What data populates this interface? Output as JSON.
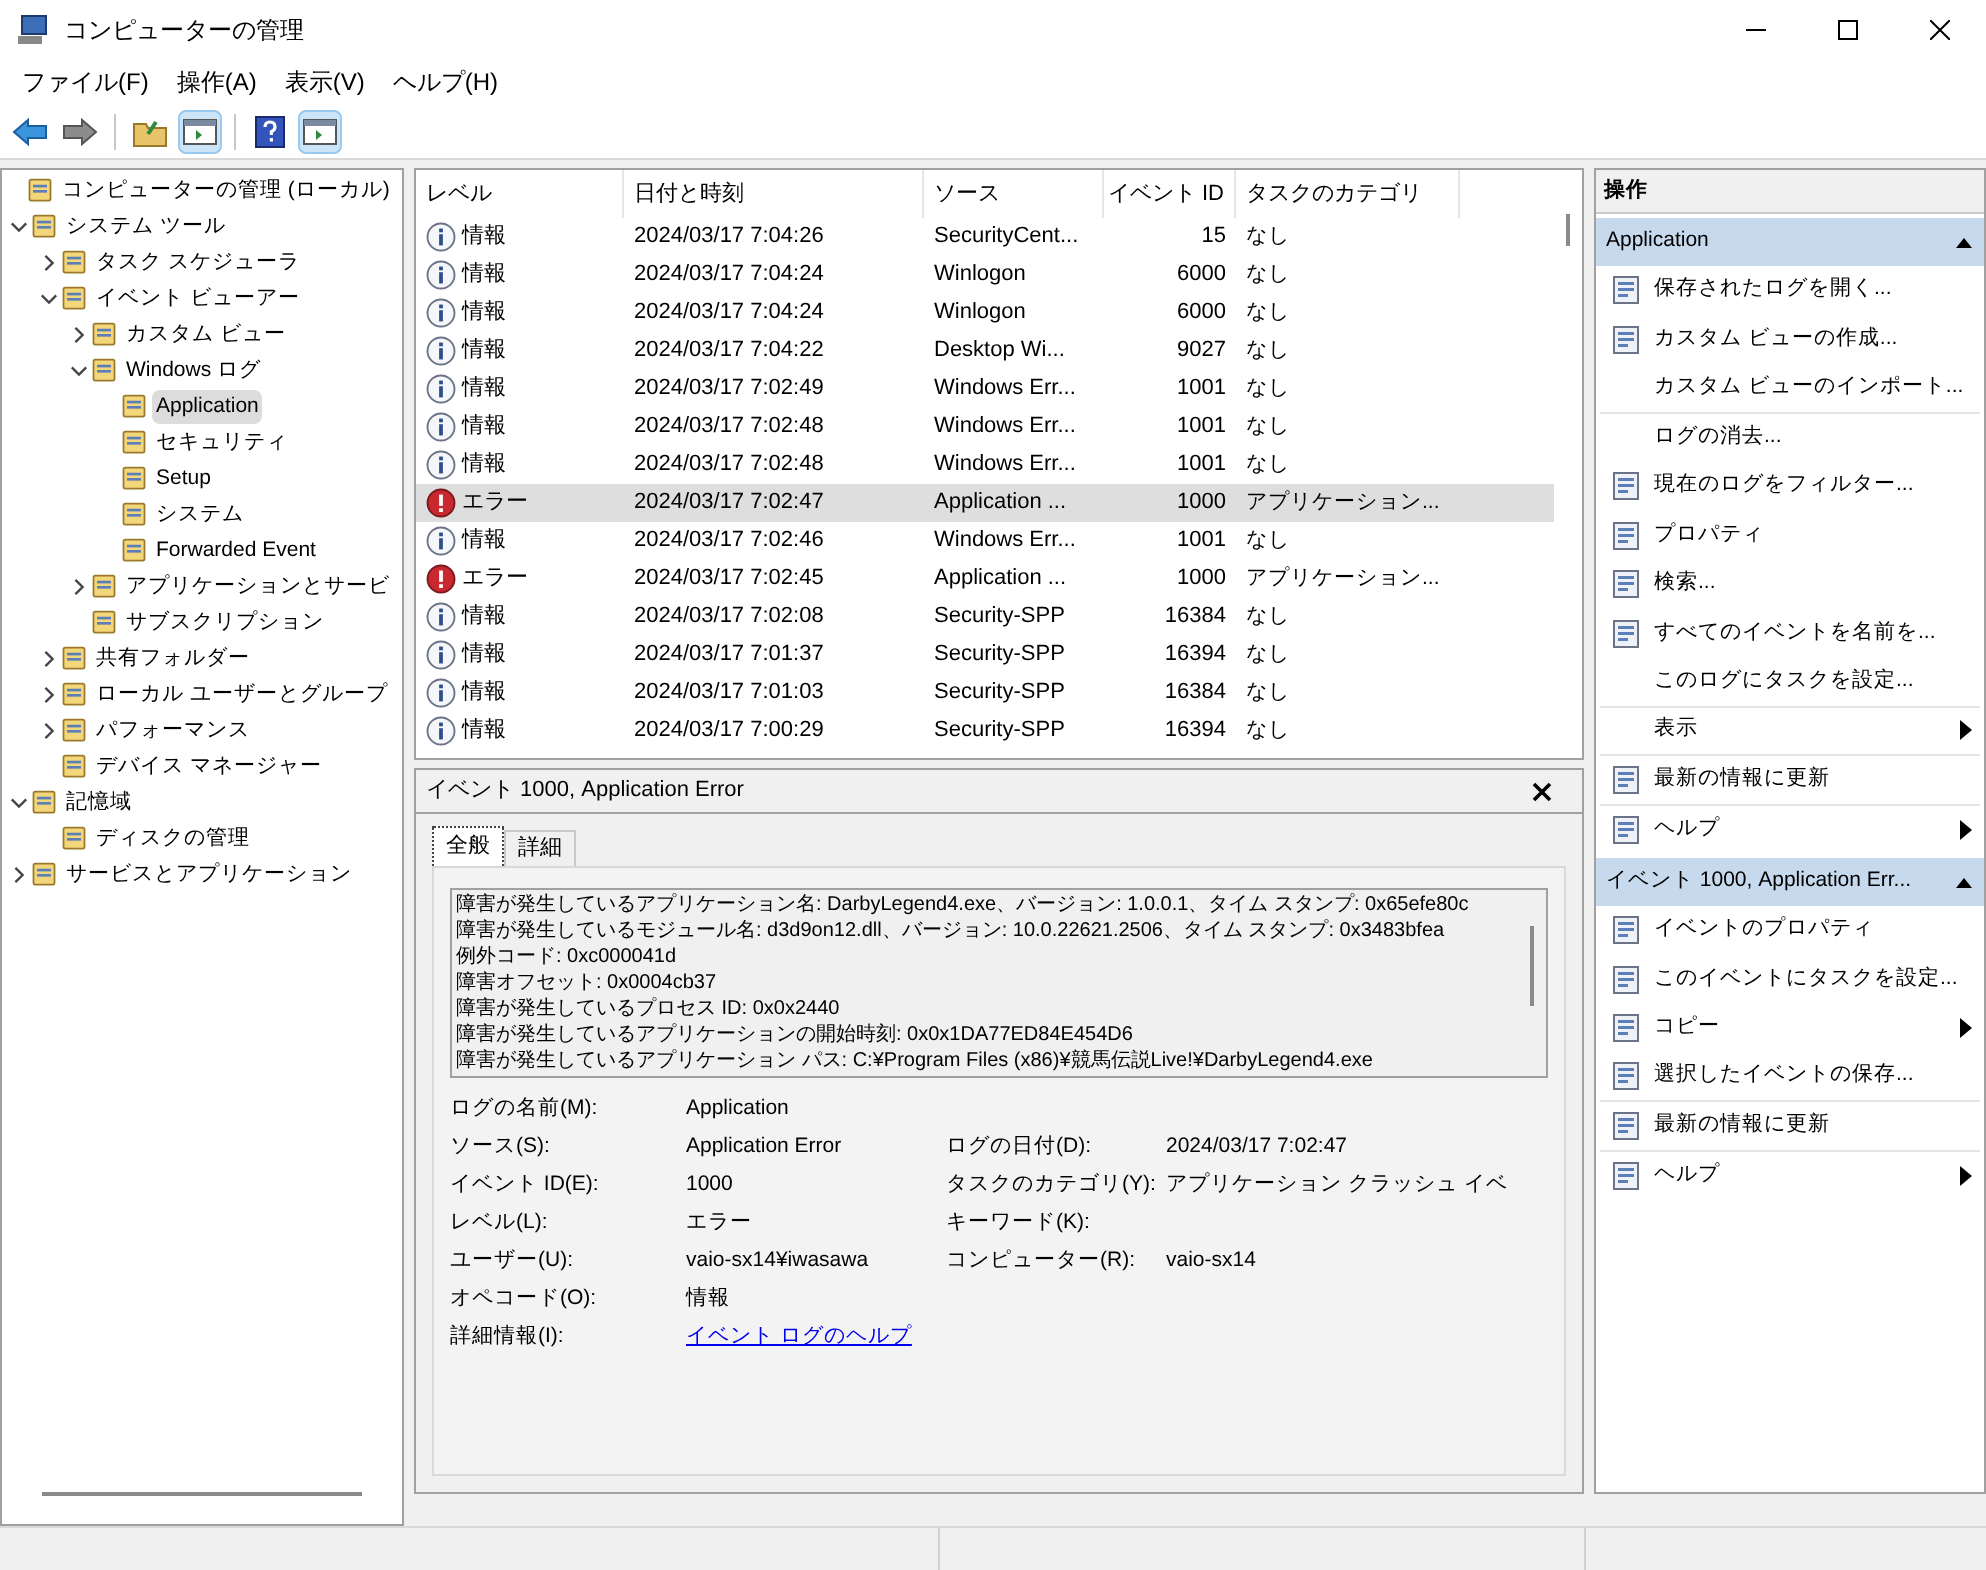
{
  "window": {
    "title": "コンピューターの管理"
  },
  "menu": [
    "ファイル(F)",
    "操作(A)",
    "表示(V)",
    "ヘルプ(H)"
  ],
  "toolbar": {
    "buttons": [
      {
        "kind": "back",
        "selected": false
      },
      {
        "kind": "forward",
        "selected": false
      },
      {
        "kind": "up",
        "selected": false
      },
      {
        "kind": "pane",
        "selected": true
      },
      {
        "kind": "help",
        "selected": false
      },
      {
        "kind": "pane",
        "selected": true
      }
    ]
  },
  "tree": [
    {
      "label": "コンピューターの管理 (ローカル)",
      "selected": false,
      "children": [
        {
          "label": "システム ツール",
          "selected": false,
          "expanded": true,
          "children": [
            {
              "label": "タスク スケジューラ",
              "selected": false,
              "expanded": false
            },
            {
              "label": "イベント ビューアー",
              "selected": false,
              "expanded": true,
              "children": [
                {
                  "label": "カスタム ビュー",
                  "selected": false,
                  "expanded": false
                },
                {
                  "label": "Windows ログ",
                  "selected": false,
                  "expanded": true,
                  "children": [
                    {
                      "label": "Application",
                      "selected": true
                    },
                    {
                      "label": "セキュリティ",
                      "selected": false
                    },
                    {
                      "label": "Setup",
                      "selected": false
                    },
                    {
                      "label": "システム",
                      "selected": false
                    },
                    {
                      "label": "Forwarded Event",
                      "selected": false
                    }
                  ]
                },
                {
                  "label": "アプリケーションとサービ",
                  "selected": false,
                  "expanded": false
                },
                {
                  "label": "サブスクリプション",
                  "selected": false
                }
              ]
            },
            {
              "label": "共有フォルダー",
              "selected": false,
              "expanded": false
            },
            {
              "label": "ローカル ユーザーとグループ",
              "selected": false,
              "expanded": false
            },
            {
              "label": "パフォーマンス",
              "selected": false,
              "expanded": false
            },
            {
              "label": "デバイス マネージャー",
              "selected": false
            }
          ]
        },
        {
          "label": "記憶域",
          "selected": false,
          "expanded": true,
          "children": [
            {
              "label": "ディスクの管理",
              "selected": false
            }
          ]
        },
        {
          "label": "サービスとアプリケーション",
          "selected": false,
          "expanded": false
        }
      ]
    }
  ],
  "events": {
    "columns": [
      "レベル",
      "日付と時刻",
      "ソース",
      "イベント ID",
      "タスクのカテゴリ"
    ],
    "rows": [
      {
        "kind": "info",
        "level": "情報",
        "date": "2024/03/17 7:04:26",
        "source": "SecurityCent...",
        "id": "15",
        "category": "なし",
        "selected": false
      },
      {
        "kind": "info",
        "level": "情報",
        "date": "2024/03/17 7:04:24",
        "source": "Winlogon",
        "id": "6000",
        "category": "なし",
        "selected": false
      },
      {
        "kind": "info",
        "level": "情報",
        "date": "2024/03/17 7:04:24",
        "source": "Winlogon",
        "id": "6000",
        "category": "なし",
        "selected": false
      },
      {
        "kind": "info",
        "level": "情報",
        "date": "2024/03/17 7:04:22",
        "source": "Desktop Wi...",
        "id": "9027",
        "category": "なし",
        "selected": false
      },
      {
        "kind": "info",
        "level": "情報",
        "date": "2024/03/17 7:02:49",
        "source": "Windows Err...",
        "id": "1001",
        "category": "なし",
        "selected": false
      },
      {
        "kind": "info",
        "level": "情報",
        "date": "2024/03/17 7:02:48",
        "source": "Windows Err...",
        "id": "1001",
        "category": "なし",
        "selected": false
      },
      {
        "kind": "info",
        "level": "情報",
        "date": "2024/03/17 7:02:48",
        "source": "Windows Err...",
        "id": "1001",
        "category": "なし",
        "selected": false
      },
      {
        "kind": "error",
        "level": "エラー",
        "date": "2024/03/17 7:02:47",
        "source": "Application ...",
        "id": "1000",
        "category": "アプリケーション...",
        "selected": true
      },
      {
        "kind": "info",
        "level": "情報",
        "date": "2024/03/17 7:02:46",
        "source": "Windows Err...",
        "id": "1001",
        "category": "なし",
        "selected": false
      },
      {
        "kind": "error",
        "level": "エラー",
        "date": "2024/03/17 7:02:45",
        "source": "Application ...",
        "id": "1000",
        "category": "アプリケーション...",
        "selected": false
      },
      {
        "kind": "info",
        "level": "情報",
        "date": "2024/03/17 7:02:08",
        "source": "Security-SPP",
        "id": "16384",
        "category": "なし",
        "selected": false
      },
      {
        "kind": "info",
        "level": "情報",
        "date": "2024/03/17 7:01:37",
        "source": "Security-SPP",
        "id": "16394",
        "category": "なし",
        "selected": false
      },
      {
        "kind": "info",
        "level": "情報",
        "date": "2024/03/17 7:01:03",
        "source": "Security-SPP",
        "id": "16384",
        "category": "なし",
        "selected": false
      },
      {
        "kind": "info",
        "level": "情報",
        "date": "2024/03/17 7:00:29",
        "source": "Security-SPP",
        "id": "16394",
        "category": "なし",
        "selected": false
      }
    ]
  },
  "detail": {
    "title": "イベント 1000, Application Error",
    "tabs": [
      {
        "label": "全般",
        "selected": true
      },
      {
        "label": "詳細",
        "selected": false
      }
    ],
    "description": [
      "障害が発生しているアプリケーション名: DarbyLegend4.exe、バージョン: 1.0.0.1、タイム スタンプ: 0x65efe80c",
      "障害が発生しているモジュール名: d3d9on12.dll、バージョン: 10.0.22621.2506、タイム スタンプ: 0x3483bfea",
      "例外コード: 0xc000041d",
      "障害オフセット: 0x0004cb37",
      "障害が発生しているプロセス ID: 0x0x2440",
      "障害が発生しているアプリケーションの開始時刻: 0x0x1DA77ED84E454D6",
      "障害が発生しているアプリケーション パス: C:¥Program Files (x86)¥競馬伝説Live!¥DarbyLegend4.exe"
    ],
    "fields": [
      [
        {
          "label": "ログの名前(M):",
          "value": "Application"
        }
      ],
      [
        {
          "label": "ソース(S):",
          "value": "Application Error"
        },
        {
          "label": "ログの日付(D):",
          "value": "2024/03/17 7:02:47"
        }
      ],
      [
        {
          "label": "イベント ID(E):",
          "value": "1000"
        },
        {
          "label": "タスクのカテゴリ(Y):",
          "value": "アプリケーション クラッシュ イベ"
        }
      ],
      [
        {
          "label": "レベル(L):",
          "value": "エラー"
        },
        {
          "label": "キーワード(K):"
        }
      ],
      [
        {
          "label": "ユーザー(U):",
          "value": "vaio-sx14¥iwasawa"
        },
        {
          "label": "コンピューター(R):",
          "value": "vaio-sx14"
        }
      ],
      [
        {
          "label": "オペコード(O):",
          "value": "情報"
        }
      ],
      [
        {
          "label": "詳細情報(I):",
          "link": "イベント ログのヘルプ"
        }
      ]
    ]
  },
  "actions": {
    "title": "操作",
    "sections": [
      {
        "title": "Application",
        "expanded": true,
        "items": [
          {
            "label": "保存されたログを開く...",
            "icon": true
          },
          {
            "label": "カスタム ビューの作成...",
            "icon": true
          },
          {
            "label": "カスタム ビューのインポート...",
            "icon": false,
            "divider": true
          },
          {
            "label": "ログの消去...",
            "icon": false
          },
          {
            "label": "現在のログをフィルター...",
            "icon": true
          },
          {
            "label": "プロパティ",
            "icon": true
          },
          {
            "label": "検索...",
            "icon": true
          },
          {
            "label": "すべてのイベントを名前を...",
            "icon": true
          },
          {
            "label": "このログにタスクを設定...",
            "icon": false,
            "divider": true
          },
          {
            "label": "表示",
            "icon": false,
            "submenu": true,
            "divider": true
          },
          {
            "label": "最新の情報に更新",
            "icon": true,
            "divider": true
          },
          {
            "label": "ヘルプ",
            "icon": true,
            "submenu": true
          }
        ]
      },
      {
        "title": "イベント 1000, Application Err...",
        "expanded": true,
        "items": [
          {
            "label": "イベントのプロパティ",
            "icon": true
          },
          {
            "label": "このイベントにタスクを設定...",
            "icon": true
          },
          {
            "label": "コピー",
            "icon": true,
            "submenu": true
          },
          {
            "label": "選択したイベントの保存...",
            "icon": true,
            "divider": true
          },
          {
            "label": "最新の情報に更新",
            "icon": true,
            "divider": true
          },
          {
            "label": "ヘルプ",
            "icon": true,
            "submenu": true
          }
        ]
      }
    ]
  }
}
